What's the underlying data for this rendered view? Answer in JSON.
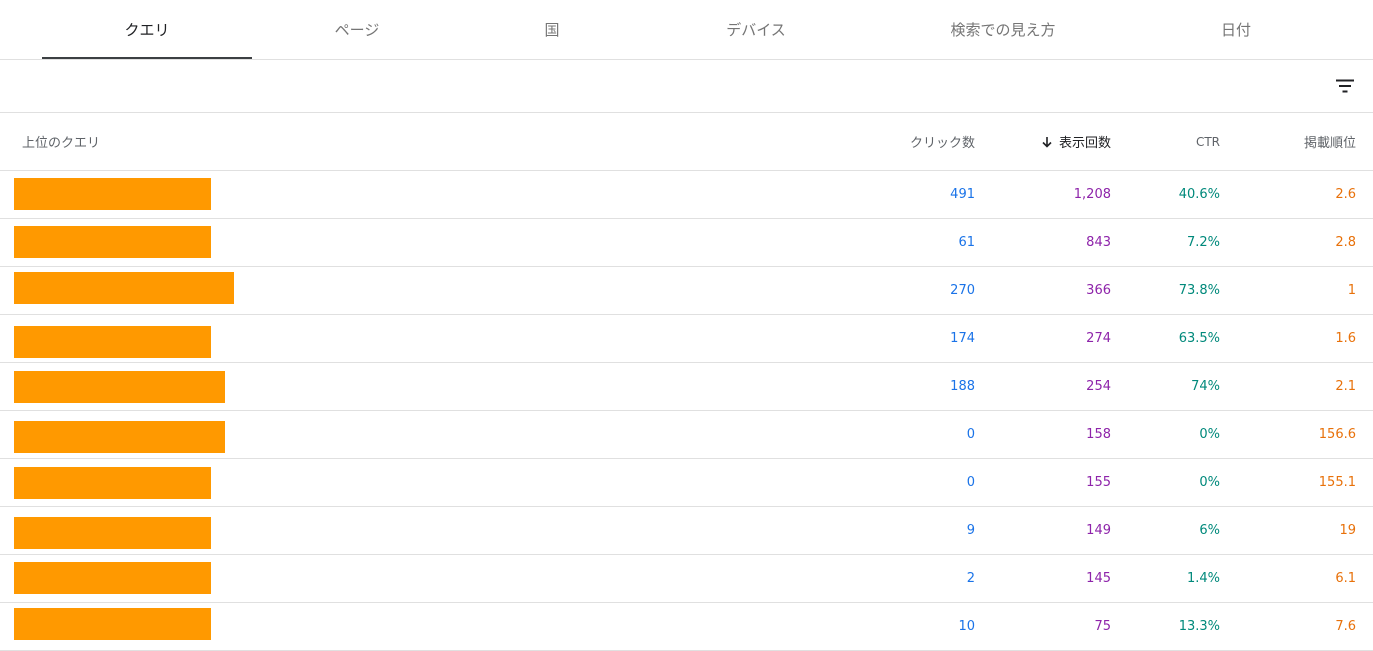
{
  "tabs": [
    {
      "label": "クエリ",
      "active": true
    },
    {
      "label": "ページ",
      "active": false
    },
    {
      "label": "国",
      "active": false
    },
    {
      "label": "デバイス",
      "active": false
    },
    {
      "label": "検索での見え方",
      "active": false
    },
    {
      "label": "日付",
      "active": false
    }
  ],
  "toolbar": {
    "filter_icon": "filter-list-icon"
  },
  "table": {
    "headers": {
      "query": "上位のクエリ",
      "clicks": "クリック数",
      "impressions": "表示回数",
      "ctr": "CTR",
      "position": "掲載順位"
    },
    "sort": {
      "column": "impressions",
      "direction": "desc",
      "icon": "arrow-down-icon"
    },
    "redaction_color": "#ff9900",
    "colors": {
      "clicks": "#1a73e8",
      "impressions": "#8e24aa",
      "ctr": "#00897b",
      "position": "#e8710a"
    },
    "rows": [
      {
        "clicks": "491",
        "impressions": "1,208",
        "ctr": "40.6%",
        "position": "2.6"
      },
      {
        "clicks": "61",
        "impressions": "843",
        "ctr": "7.2%",
        "position": "2.8"
      },
      {
        "clicks": "270",
        "impressions": "366",
        "ctr": "73.8%",
        "position": "1"
      },
      {
        "clicks": "174",
        "impressions": "274",
        "ctr": "63.5%",
        "position": "1.6"
      },
      {
        "clicks": "188",
        "impressions": "254",
        "ctr": "74%",
        "position": "2.1"
      },
      {
        "clicks": "0",
        "impressions": "158",
        "ctr": "0%",
        "position": "156.6"
      },
      {
        "clicks": "0",
        "impressions": "155",
        "ctr": "0%",
        "position": "155.1"
      },
      {
        "clicks": "9",
        "impressions": "149",
        "ctr": "6%",
        "position": "19"
      },
      {
        "clicks": "2",
        "impressions": "145",
        "ctr": "1.4%",
        "position": "6.1"
      },
      {
        "clicks": "10",
        "impressions": "75",
        "ctr": "13.3%",
        "position": "7.6"
      }
    ]
  }
}
